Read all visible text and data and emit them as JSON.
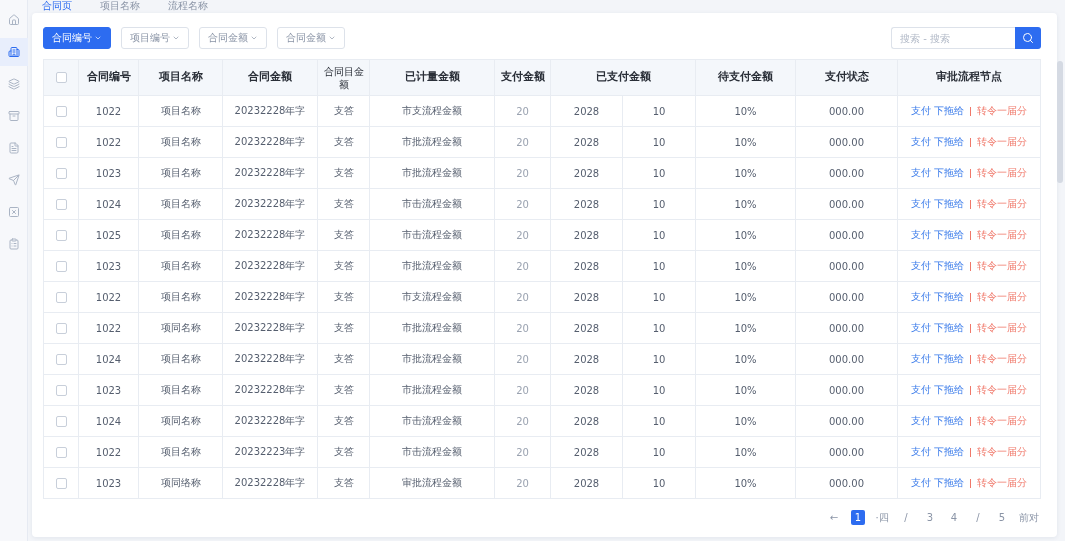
{
  "top_tabs": [
    {
      "label": "合同页",
      "selected": true
    },
    {
      "label": "项目名称",
      "selected": false
    },
    {
      "label": "流程名称",
      "selected": false
    }
  ],
  "sidebar": {
    "items": [
      {
        "selected": false
      },
      {
        "selected": true
      },
      {
        "selected": false
      },
      {
        "selected": false
      },
      {
        "selected": false
      },
      {
        "selected": false
      },
      {
        "selected": false
      },
      {
        "selected": false
      }
    ]
  },
  "filters": [
    {
      "label": "合同编号",
      "selected": true
    },
    {
      "label": "项目编号",
      "selected": false
    },
    {
      "label": "合同金额",
      "selected": false
    },
    {
      "label": "合同金额",
      "selected": false
    }
  ],
  "search": {
    "placeholder": "搜索 - 搜索"
  },
  "table": {
    "select_all": {
      "checked": false
    },
    "columns": [
      {
        "label": "合同编号"
      },
      {
        "label": "项目名称"
      },
      {
        "label": "合同金额"
      },
      {
        "label": "合同目金额"
      },
      {
        "label": "已计量金额"
      },
      {
        "label": "支付金额"
      },
      {
        "label": "已支付金额",
        "colspan": 2
      },
      {
        "label": "待支付金额"
      },
      {
        "label": "支付状态"
      },
      {
        "label": "审批流程节点"
      }
    ],
    "rows": [
      {
        "checked": false,
        "cells": [
          "1022",
          "项目名称",
          "20232228年字",
          "支答",
          "市支流程金额",
          "20",
          "2028",
          "10",
          "10%",
          "000.00"
        ],
        "actions": [
          "支付 下拖给",
          "转令一届分"
        ]
      },
      {
        "checked": false,
        "cells": [
          "1022",
          "项目名称",
          "20232228年字",
          "支答",
          "市批流程金额",
          "20",
          "2028",
          "10",
          "10%",
          "000.00"
        ],
        "actions": [
          "支付 下拖给",
          "转令一届分"
        ]
      },
      {
        "checked": false,
        "cells": [
          "1023",
          "项目名称",
          "20232228年字",
          "支答",
          "市批流程金额",
          "20",
          "2028",
          "10",
          "10%",
          "000.00"
        ],
        "actions": [
          "支付 下拖给",
          "转令一届分"
        ]
      },
      {
        "checked": false,
        "cells": [
          "1024",
          "项目名称",
          "20232228年字",
          "支答",
          "市击流程金额",
          "20",
          "2028",
          "10",
          "10%",
          "000.00"
        ],
        "actions": [
          "支付 下拖给",
          "转令一届分"
        ]
      },
      {
        "checked": false,
        "cells": [
          "1025",
          "项目名称",
          "20232228年字",
          "支答",
          "市击流程金额",
          "20",
          "2028",
          "10",
          "10%",
          "000.00"
        ],
        "actions": [
          "支付 下拖给",
          "转令一届分"
        ]
      },
      {
        "checked": false,
        "cells": [
          "1023",
          "项目名称",
          "20232228年字",
          "支答",
          "市批流程金额",
          "20",
          "2028",
          "10",
          "10%",
          "000.00"
        ],
        "actions": [
          "支付 下拖给",
          "转令一届分"
        ]
      },
      {
        "checked": false,
        "cells": [
          "1022",
          "项目名称",
          "20232228年字",
          "支答",
          "市支流程金额",
          "20",
          "2028",
          "10",
          "10%",
          "000.00"
        ],
        "actions": [
          "支付 下拖给",
          "转令一届分"
        ]
      },
      {
        "checked": false,
        "cells": [
          "1022",
          "项同名称",
          "20232228年字",
          "支答",
          "市批流程金额",
          "20",
          "2028",
          "10",
          "10%",
          "000.00"
        ],
        "actions": [
          "支付 下拖给",
          "转令一届分"
        ]
      },
      {
        "checked": false,
        "cells": [
          "1024",
          "项目名称",
          "20232228年字",
          "支答",
          "市批流程金额",
          "20",
          "2028",
          "10",
          "10%",
          "000.00"
        ],
        "actions": [
          "支付 下拖给",
          "转令一届分"
        ]
      },
      {
        "checked": false,
        "cells": [
          "1023",
          "项目名称",
          "20232228年字",
          "支答",
          "市批流程金额",
          "20",
          "2028",
          "10",
          "10%",
          "000.00"
        ],
        "actions": [
          "支付 下拖给",
          "转令一届分"
        ]
      },
      {
        "checked": false,
        "cells": [
          "1024",
          "项同名称",
          "20232228年字",
          "支答",
          "市击流程金额",
          "20",
          "2028",
          "10",
          "10%",
          "000.00"
        ],
        "actions": [
          "支付 下拖给",
          "转令一届分"
        ]
      },
      {
        "checked": false,
        "cells": [
          "1022",
          "项目名称",
          "20232223年字",
          "支答",
          "市击流程金额",
          "20",
          "2028",
          "10",
          "10%",
          "000.00"
        ],
        "actions": [
          "支付 下拖给",
          "转令一届分"
        ]
      },
      {
        "checked": false,
        "cells": [
          "1023",
          "项同络称",
          "20232228年字",
          "支答",
          "审批流程金额",
          "20",
          "2028",
          "10",
          "10%",
          "000.00"
        ],
        "actions": [
          "支付 下拖给",
          "转令一届分"
        ]
      }
    ]
  },
  "pagination": {
    "prev": "←",
    "pages": [
      {
        "label": "1",
        "selected": true
      },
      {
        "label": "·四",
        "selected": false
      },
      {
        "label": "/",
        "selected": false
      },
      {
        "label": "3",
        "selected": false
      },
      {
        "label": "4",
        "selected": false
      },
      {
        "label": "/",
        "selected": false
      },
      {
        "label": "5",
        "selected": false
      }
    ],
    "next": "前对"
  }
}
